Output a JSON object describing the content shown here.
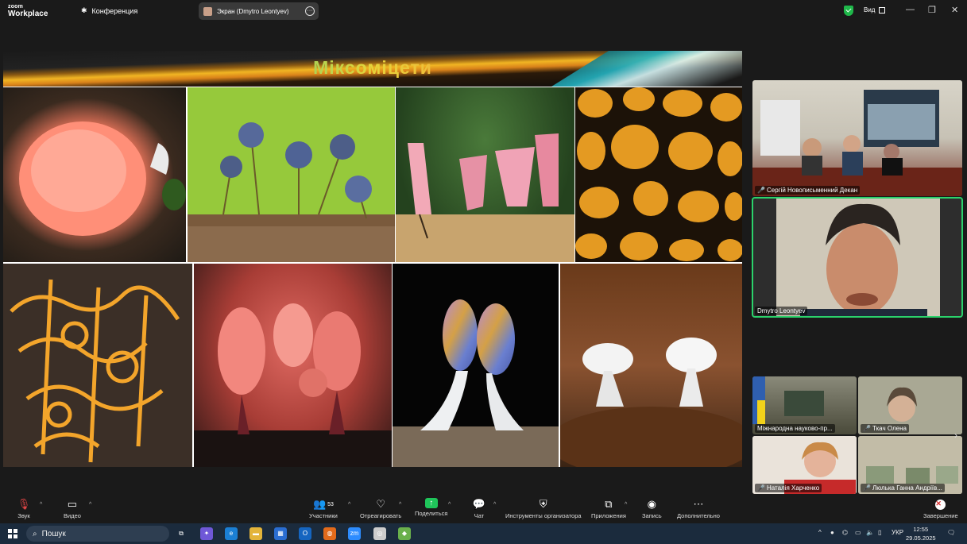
{
  "app": {
    "logo_top": "zoom",
    "logo_bottom": "Workplace",
    "conference_label": "Конференция"
  },
  "screen_share": {
    "label": "Экран (Dmytro Leontyev)"
  },
  "view": {
    "label": "Вид"
  },
  "slide": {
    "title": "Міксоміцети"
  },
  "participants": [
    {
      "name": "Сергій Новописьменний Декан",
      "muted": true
    },
    {
      "name": "Dmytro Leontyev",
      "muted": false,
      "active_speaker": true
    },
    {
      "name": "Міжнародна науково-пр...",
      "muted": false
    },
    {
      "name": "Ткач Олена",
      "muted": true
    },
    {
      "name": "Наталія Харченко",
      "muted": true
    },
    {
      "name": "Люлька Ганна Андріїв...",
      "muted": true
    }
  ],
  "toolbar": {
    "audio": "Звук",
    "video": "Видео",
    "participants": "Участники",
    "participants_count": "53",
    "react": "Отреагировать",
    "share": "Поделиться",
    "chat": "Чат",
    "host_tools": "Инструменты организатора",
    "apps": "Приложения",
    "record": "Запись",
    "more": "Дополнительно",
    "end": "Завершение"
  },
  "taskbar": {
    "search_placeholder": "Пошук",
    "lang": "УКР",
    "time": "12:55",
    "date": "29.05.2025"
  },
  "colors": {
    "accent_green": "#1fc55a",
    "end_red": "#d62a2a",
    "active_outline": "#2bd26b"
  }
}
